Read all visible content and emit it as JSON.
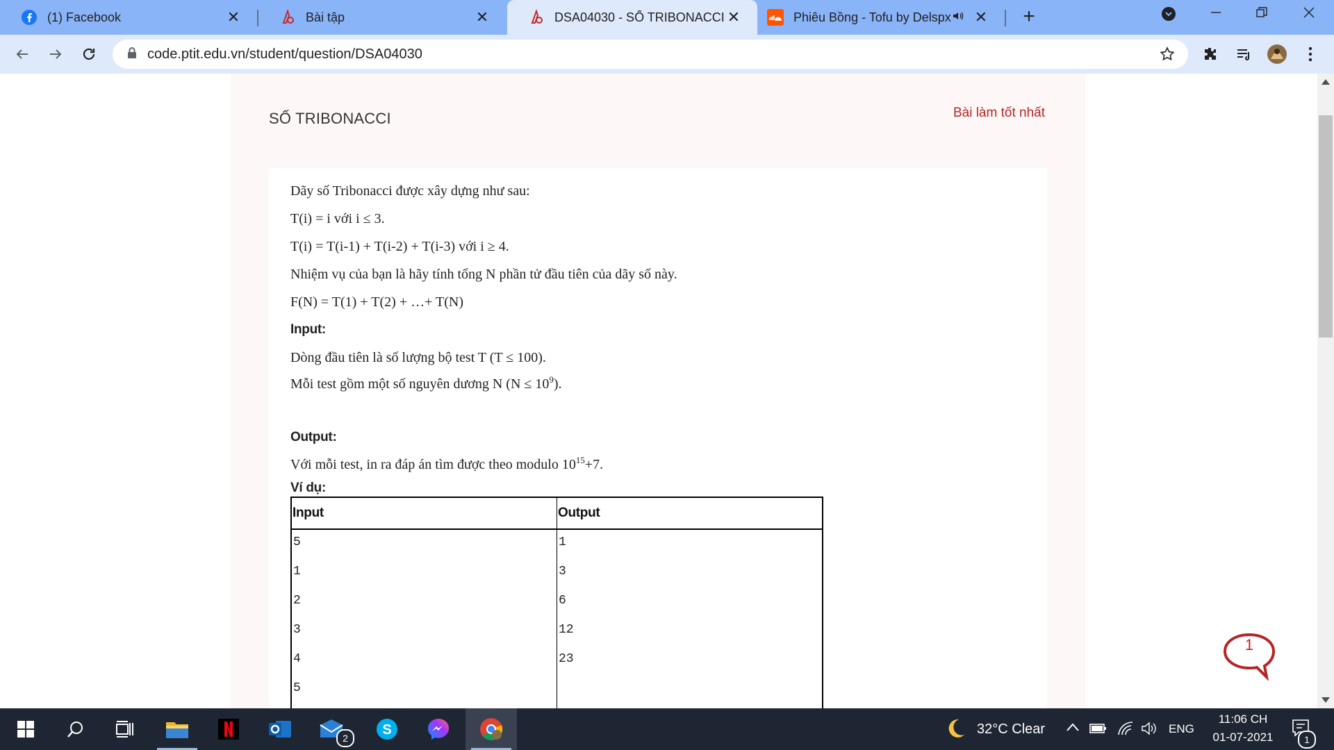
{
  "browser": {
    "tabs": [
      {
        "title": "(1) Facebook",
        "icon": "facebook-icon",
        "active": false
      },
      {
        "title": "Bài tập",
        "icon": "ptit-icon",
        "active": false
      },
      {
        "title": "DSA04030 - SỐ TRIBONACCI",
        "icon": "ptit-icon",
        "active": true
      },
      {
        "title": "Phiêu Bồng - Tofu by Delspx",
        "icon": "soundcloud-icon",
        "active": false
      }
    ],
    "url": "code.ptit.edu.vn/student/question/DSA04030"
  },
  "problem": {
    "title": "SỐ TRIBONACCI",
    "best_link": "Bài làm tốt nhất",
    "lines": [
      "Dãy số Tribonacci được xây dựng như sau:",
      "T(i) = i với i ≤ 3.",
      "T(i) = T(i-1) + T(i-2) + T(i-3) với i ≥ 4.",
      "Nhiệm vụ của bạn là hãy tính tổng N phần tử đầu tiên của dãy số này.",
      "F(N) = T(1) + T(2) + …+ T(N)"
    ],
    "input_heading": "Input:",
    "input_line1": "Dòng đầu tiên là số lượng bộ test T (T ≤ 100).",
    "input_line2_pre": "Mỗi test gồm một số nguyên dương N (N ≤ 10",
    "input_line2_sup": "9",
    "input_line2_post": ").",
    "output_heading": "Output:",
    "output_line_pre": "Với mỗi test, in ra đáp án tìm được theo modulo 10",
    "output_line_sup": "15",
    "output_line_post": "+7.",
    "example_heading": "Ví dụ:",
    "example": {
      "headers": [
        "Input",
        "Output"
      ],
      "input": [
        "5",
        "1",
        "2",
        "3",
        "4",
        "5"
      ],
      "output": [
        "1",
        "3",
        "6",
        "12",
        "23"
      ]
    }
  },
  "chat": {
    "count": "1"
  },
  "taskbar": {
    "weather": "32°C  Clear",
    "language": "ENG",
    "time": "11:06 CH",
    "date": "01-07-2021",
    "mail_badge": "2",
    "notification_badge": "1"
  },
  "colors": {
    "tabstrip": "#8ab4f8",
    "toolbar": "#dee9fb",
    "card_bg": "#fdf8f7",
    "link_red": "#b52626",
    "taskbar": "#1f2633"
  }
}
